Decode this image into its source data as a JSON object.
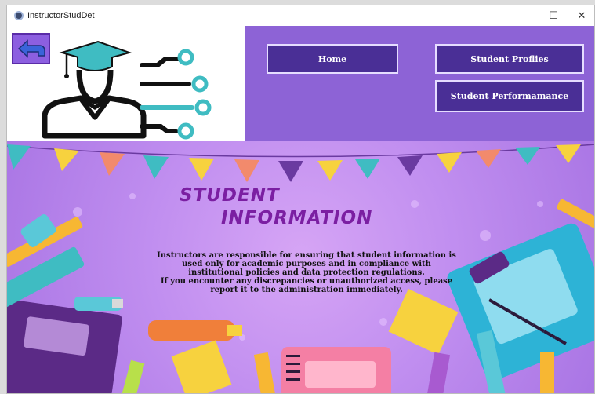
{
  "window": {
    "title": "InstructorStudDet",
    "controls": {
      "minimize": "—",
      "maximize": "☐",
      "close": "✕"
    }
  },
  "nav": {
    "home_label": "Home",
    "profiles_label": "Student Proflies",
    "performance_label": "Student Performamance"
  },
  "banner": {
    "heading_line1": "STUDENT",
    "heading_line2": "INFORMATION",
    "notice": [
      "Instructors are responsible for ensuring that student information is",
      "used only for academic purposes and in compliance with",
      "institutional policies and data protection regulations.",
      "If you encounter any discrepancies or unauthorized access, please",
      "report it to the administration immediately."
    ]
  },
  "colors": {
    "header_purple": "#8d63d6",
    "nav_button": "#4a2f96",
    "back_button": "#8c5fe0",
    "heading": "#7b1fa2",
    "logo_teal": "#3fbcc2"
  },
  "icons": {
    "back": "back-arrow-icon",
    "logo": "graduate-logo-icon"
  }
}
